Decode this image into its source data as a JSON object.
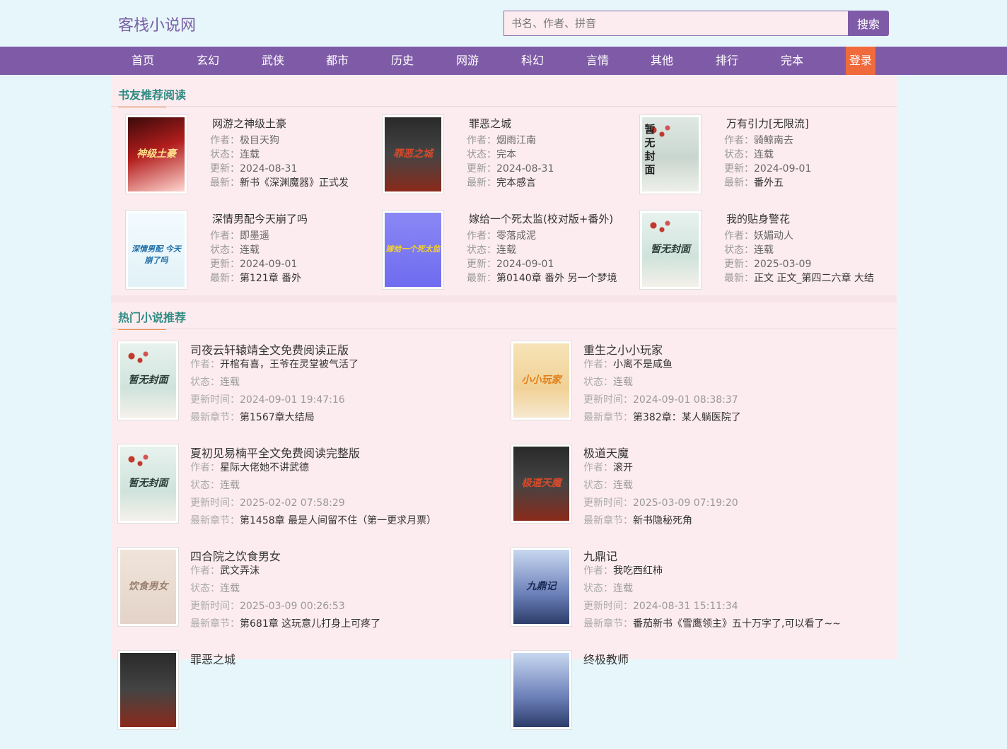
{
  "site": {
    "logo": "客栈小说网"
  },
  "search": {
    "placeholder": "书名、作者、拼音",
    "button": "搜索"
  },
  "nav": [
    "首页",
    "玄幻",
    "武侠",
    "都市",
    "历史",
    "网游",
    "科幻",
    "言情",
    "其他",
    "排行",
    "完本"
  ],
  "login": "登录",
  "labels": {
    "author": "作者：",
    "status": "状态：",
    "updated": "更新：",
    "latest": "最新：",
    "updated_time": "更新时间：",
    "latest_chapter": "最新章节："
  },
  "recommend": {
    "title": "书友推荐阅读",
    "books": [
      {
        "title": "网游之神级土豪",
        "author": "极目天狗",
        "status": "连载",
        "updated": "2024-08-31",
        "latest": "新书《深渊魔器》正式发",
        "cover_text": "神级土豪",
        "cover_style": "red"
      },
      {
        "title": "罪恶之城",
        "author": "烟雨江南",
        "status": "完本",
        "updated": "2024-08-31",
        "latest": "完本感言",
        "cover_text": "罪恶之城",
        "cover_style": "dark"
      },
      {
        "title": "万有引力[无限流]",
        "author": "骑鲸南去",
        "status": "连载",
        "updated": "2024-09-01",
        "latest": "番外五",
        "cover_text": "暂无封面",
        "cover_style": "placeholder-vertical"
      },
      {
        "title": "深情男配今天崩了吗",
        "author": "即墨遥",
        "status": "连载",
        "updated": "2024-09-01",
        "latest": "第121章 番外",
        "cover_text": "深情男配 今天 崩了吗",
        "cover_style": "light"
      },
      {
        "title": "嫁给一个死太监(校对版+番外)",
        "author": "零落成泥",
        "status": "连载",
        "updated": "2024-09-01",
        "latest": "第0140章 番外 另一个梦境",
        "cover_text": "嫁给一个死太监",
        "cover_style": "purple"
      },
      {
        "title": "我的贴身警花",
        "author": "妖媚动人",
        "status": "连载",
        "updated": "2025-03-09",
        "latest": "正文 正文_第四二六章 大结",
        "cover_text": "暂无封面",
        "cover_style": "placeholder"
      }
    ]
  },
  "hot": {
    "title": "热门小说推荐",
    "books": [
      {
        "title": "司夜云轩辕靖全文免费阅读正版",
        "author": "开棺有喜，王爷在灵堂被气活了",
        "status": "连载",
        "updated": "2024-09-01 19:47:16",
        "latest": "第1567章大结局",
        "cover_text": "暂无封面",
        "cover_style": "placeholder"
      },
      {
        "title": "重生之小小玩家",
        "author": "小离不是咸鱼",
        "status": "连载",
        "updated": "2024-09-01 08:38:37",
        "latest": "第382章：某人躺医院了",
        "cover_text": "小小玩家",
        "cover_style": "gold"
      },
      {
        "title": "夏初见易楠平全文免费阅读完整版",
        "author": "星际大佬她不讲武德",
        "status": "连载",
        "updated": "2025-02-02 07:58:29",
        "latest": "第1458章 最是人间留不住（第一更求月票）",
        "cover_text": "暂无封面",
        "cover_style": "placeholder"
      },
      {
        "title": "极道天魔",
        "author": "滚开",
        "status": "连载",
        "updated": "2025-03-09 07:19:20",
        "latest": "新书隐秘死角",
        "cover_text": "极道天魔",
        "cover_style": "dark"
      },
      {
        "title": "四合院之饮食男女",
        "author": "武文弄沫",
        "status": "连载",
        "updated": "2025-03-09 00:26:53",
        "latest": "第681章 这玩意儿打身上可疼了",
        "cover_text": "饮食男女",
        "cover_style": "beige"
      },
      {
        "title": "九鼎记",
        "author": "我吃西红柿",
        "status": "连载",
        "updated": "2024-08-31 15:11:34",
        "latest": "番茄新书《雪鹰领主》五十万字了,可以看了~~",
        "cover_text": "九鼎记",
        "cover_style": "blue"
      },
      {
        "title": "罪恶之城",
        "cover_style": "dark"
      },
      {
        "title": "终极教师",
        "cover_style": "blue"
      }
    ]
  },
  "colors": {
    "brand": "#7f5ba7",
    "login": "#f06a3c",
    "section_title": "#2e8b83",
    "underline": "#f08c4a",
    "panel": "#fdecef",
    "page_bg": "#e6f6fa"
  }
}
